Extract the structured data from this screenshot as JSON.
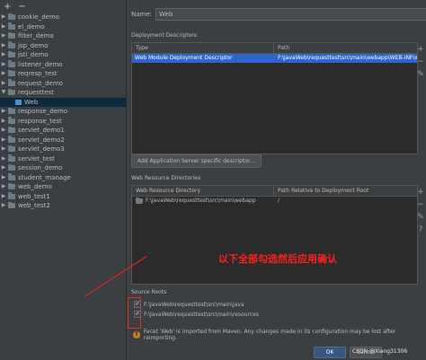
{
  "tree": {
    "items": [
      {
        "label": "cookie_demo",
        "expanded": false
      },
      {
        "label": "el_demo",
        "expanded": false
      },
      {
        "label": "filter_demo",
        "expanded": false
      },
      {
        "label": "jsp_demo",
        "expanded": false
      },
      {
        "label": "jstl_demo",
        "expanded": false
      },
      {
        "label": "listener_demo",
        "expanded": false
      },
      {
        "label": "reqresp_test",
        "expanded": false
      },
      {
        "label": "request_demo",
        "expanded": false
      },
      {
        "label": "requesttest",
        "expanded": true
      },
      {
        "label": "Web",
        "child": true,
        "selected": true
      },
      {
        "label": "response_demo",
        "expanded": false
      },
      {
        "label": "response_test",
        "expanded": false
      },
      {
        "label": "servlet_demo1",
        "expanded": false
      },
      {
        "label": "servlet_demo2",
        "expanded": false
      },
      {
        "label": "servlet_demo3",
        "expanded": false
      },
      {
        "label": "servlet_test",
        "expanded": false
      },
      {
        "label": "session_demo",
        "expanded": false
      },
      {
        "label": "student_manage",
        "expanded": false
      },
      {
        "label": "web_demo",
        "expanded": false
      },
      {
        "label": "web_test1",
        "expanded": false
      },
      {
        "label": "web_test2",
        "expanded": false
      }
    ],
    "add_icon": "+",
    "remove_icon": "−"
  },
  "name": {
    "label": "Name:",
    "value": "Web"
  },
  "deployment": {
    "title": "Deployment Descriptors",
    "columns": [
      "Type",
      "Path"
    ],
    "rows": [
      {
        "type": "Web Module Deployment Descriptor",
        "path": "F:\\JavaWeb\\requesttest\\src\\main\\webapp\\WEB-INF\\web"
      }
    ],
    "add_button": "Add Application Server specific descriptor..."
  },
  "resources": {
    "title": "Web Resource Directories",
    "columns": [
      "Web Resource Directory",
      "Path Relative to Deployment Root"
    ],
    "rows": [
      {
        "dir": "F:\\JavaWeb\\requesttest\\src\\main\\webapp",
        "rel": "/"
      }
    ]
  },
  "annotation": "以下全部勾选然后应用确认",
  "source_roots": {
    "title": "Source Roots",
    "items": [
      {
        "path": "F:\\JavaWeb\\requesttest\\src\\main\\java",
        "checked": true
      },
      {
        "path": "F:\\JavaWeb\\requesttest\\src\\main\\resources",
        "checked": true
      }
    ]
  },
  "warning": "Facet 'Web' is imported from Maven. Any changes made in its configuration may be lost after reimporting.",
  "buttons": {
    "ok": "OK",
    "cancel": "Cancel"
  },
  "watermark": "CSDN @Xiang31306",
  "colors": {
    "selection": "#2f65ca",
    "annotation": "#ff2020",
    "warning": "#c9832b"
  }
}
